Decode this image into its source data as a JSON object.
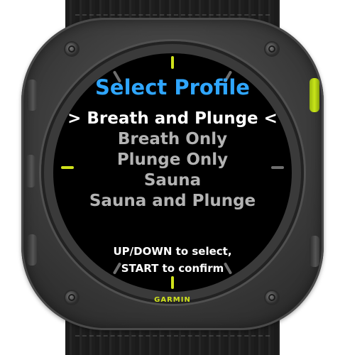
{
  "screen": {
    "title": "Select Profile",
    "profiles": [
      {
        "label": "> Breath and Plunge <",
        "selected": true
      },
      {
        "label": "Breath Only",
        "selected": false
      },
      {
        "label": "Plunge Only",
        "selected": false
      },
      {
        "label": "Sauna",
        "selected": false
      },
      {
        "label": "Sauna and Plunge",
        "selected": false
      }
    ],
    "instructions": {
      "line1": "UP/DOWN to select,",
      "line2": "START to confirm"
    }
  },
  "device": {
    "brand": "GARMIN",
    "accent_color": "#cfe21b",
    "title_color": "#2fa6ff"
  }
}
